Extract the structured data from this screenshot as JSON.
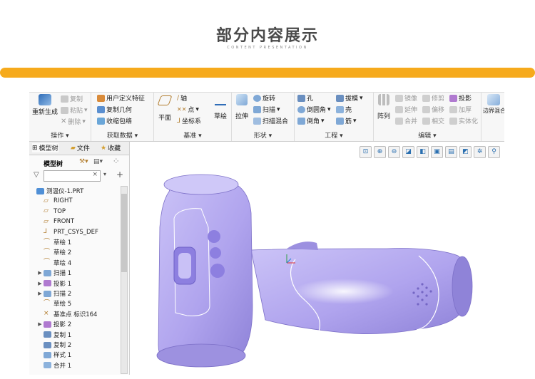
{
  "header": {
    "title": "部分内容展示",
    "subtitle": "CONTENT PRESENTATION"
  },
  "ribbon": {
    "groups": {
      "operation": "操作",
      "get_data": "获取数据",
      "datum": "基准",
      "shape": "形状",
      "engineering": "工程",
      "edit": "编辑"
    },
    "operation": {
      "regenerate": "重新生成",
      "copy": "复制",
      "paste": "粘贴",
      "delete": "删除"
    },
    "get_data": {
      "udf": "用户定义特征",
      "copy_geom": "复制几何",
      "shrinkwrap": "收缩包络"
    },
    "datum": {
      "plane": "平面",
      "axis": "轴",
      "point": "点",
      "csys": "坐标系",
      "sketch": "草绘"
    },
    "shape": {
      "extrude": "拉伸",
      "revolve": "旋转",
      "sweep": "扫描",
      "swept_blend": "扫描混合"
    },
    "engineering": {
      "hole": "孔",
      "draft": "拔模",
      "round": "倒圆角",
      "shell": "壳",
      "chamfer": "倒角",
      "rib": "筋"
    },
    "edit": {
      "pattern": "阵列",
      "mirror": "镜像",
      "trim": "修剪",
      "project": "投影",
      "extend": "延伸",
      "offset": "偏移",
      "thicken": "加厚",
      "merge": "合并",
      "intersect": "相交",
      "solidify": "实体化",
      "boundary_blend": "边界混合"
    }
  },
  "left_panel": {
    "tabs": [
      "模型树",
      "文件",
      "收藏"
    ],
    "model_tree_label": "模型树",
    "filter_placeholder": "",
    "items": [
      {
        "label": "测温仪-1.PRT",
        "icon": "part-icon",
        "expand": ""
      },
      {
        "label": "RIGHT",
        "icon": "datum-plane-icon",
        "expand": ""
      },
      {
        "label": "TOP",
        "icon": "datum-plane-icon",
        "expand": ""
      },
      {
        "label": "FRONT",
        "icon": "datum-plane-icon",
        "expand": ""
      },
      {
        "label": "PRT_CSYS_DEF",
        "icon": "csys-icon",
        "expand": ""
      },
      {
        "label": "草绘 1",
        "icon": "sketch-icon",
        "expand": ""
      },
      {
        "label": "草绘 2",
        "icon": "sketch-icon",
        "expand": ""
      },
      {
        "label": "草绘 4",
        "icon": "sketch-icon",
        "expand": ""
      },
      {
        "label": "扫描 1",
        "icon": "sweep-icon",
        "expand": "▶"
      },
      {
        "label": "投影 1",
        "icon": "project-icon",
        "expand": "▶"
      },
      {
        "label": "扫描 2",
        "icon": "sweep-icon",
        "expand": "▶"
      },
      {
        "label": "草绘 5",
        "icon": "sketch-icon",
        "expand": ""
      },
      {
        "label": "基准点 标识164",
        "icon": "datum-point-icon",
        "expand": ""
      },
      {
        "label": "投影 2",
        "icon": "project-icon",
        "expand": "▶"
      },
      {
        "label": "复制 1",
        "icon": "copy-icon",
        "expand": ""
      },
      {
        "label": "复制 2",
        "icon": "copy-icon",
        "expand": ""
      },
      {
        "label": "样式 1",
        "icon": "style-icon",
        "expand": ""
      },
      {
        "label": "合并 1",
        "icon": "merge-icon",
        "expand": ""
      }
    ]
  },
  "colors": {
    "accent_bar": "#f6aa1c",
    "model_body": "#b4a8ef",
    "model_shadow": "#8c80d6",
    "buttons": "#8d7fe0"
  }
}
